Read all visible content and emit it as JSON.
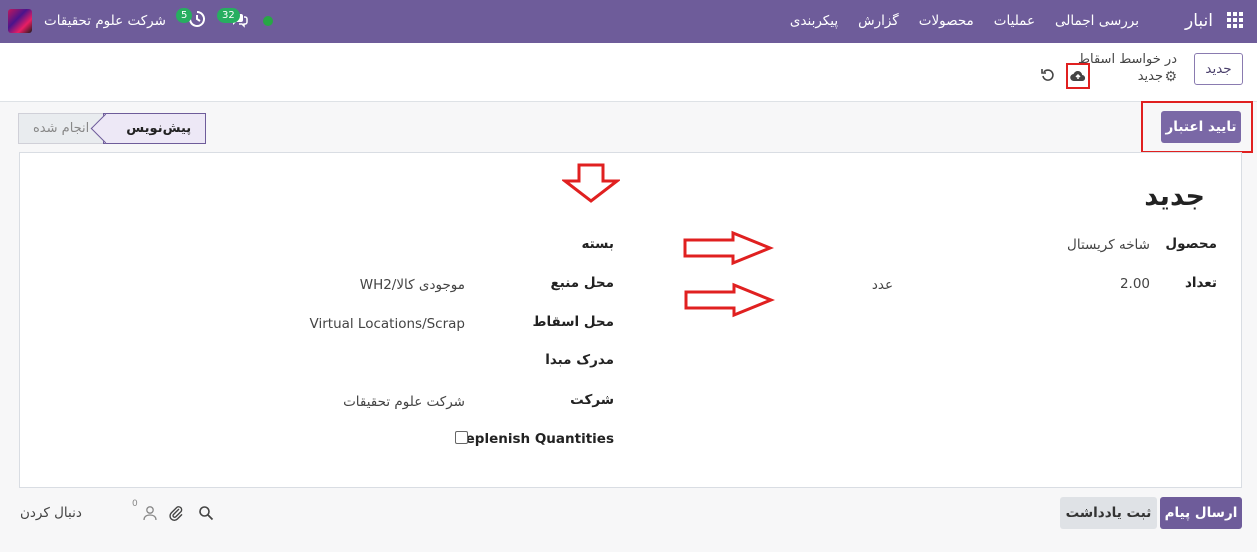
{
  "navbar": {
    "app_name": "انبار",
    "menu": [
      "بررسی اجمالی",
      "عملیات",
      "محصولات",
      "گزارش",
      "پیکربندی"
    ],
    "company": "شرکت علوم تحقیقات",
    "activity_count": "5",
    "message_count": "32"
  },
  "control_panel": {
    "new_button": "جدید",
    "breadcrumb": "در خواسط اسقاط",
    "record_title": "جدید"
  },
  "statusbar": {
    "validate_button": "تایید اعتبار",
    "stages": [
      "پیش‌نویس",
      "انجام شده"
    ],
    "active_stage": "پیش‌نویس"
  },
  "form": {
    "title": "جدید",
    "product_label": "محصول",
    "product_value": "شاخه کریستال",
    "quantity_label": "تعداد",
    "quantity_value": "2.00",
    "uom_value": "عدد",
    "package_label": "بسته",
    "source_label": "محل منبع",
    "source_value": "WH2/موجودی کالا",
    "scrap_label": "محل اسقاط",
    "scrap_value": "Virtual Locations/Scrap",
    "origin_label": "مدرک مبدا",
    "company_label": "شرکت",
    "company_value": "شرکت علوم تحقیقات",
    "replenish_label": "Replenish Quantities",
    "replenish_checked": false
  },
  "chatter": {
    "send_message": "ارسال پیام",
    "log_note": "ثبت یادداشت",
    "follow": "دنبال کردن",
    "followers_count": "0"
  },
  "colors": {
    "primary": "#6e5c9a",
    "annotation": "#e02020",
    "badge": "#27ae60"
  }
}
